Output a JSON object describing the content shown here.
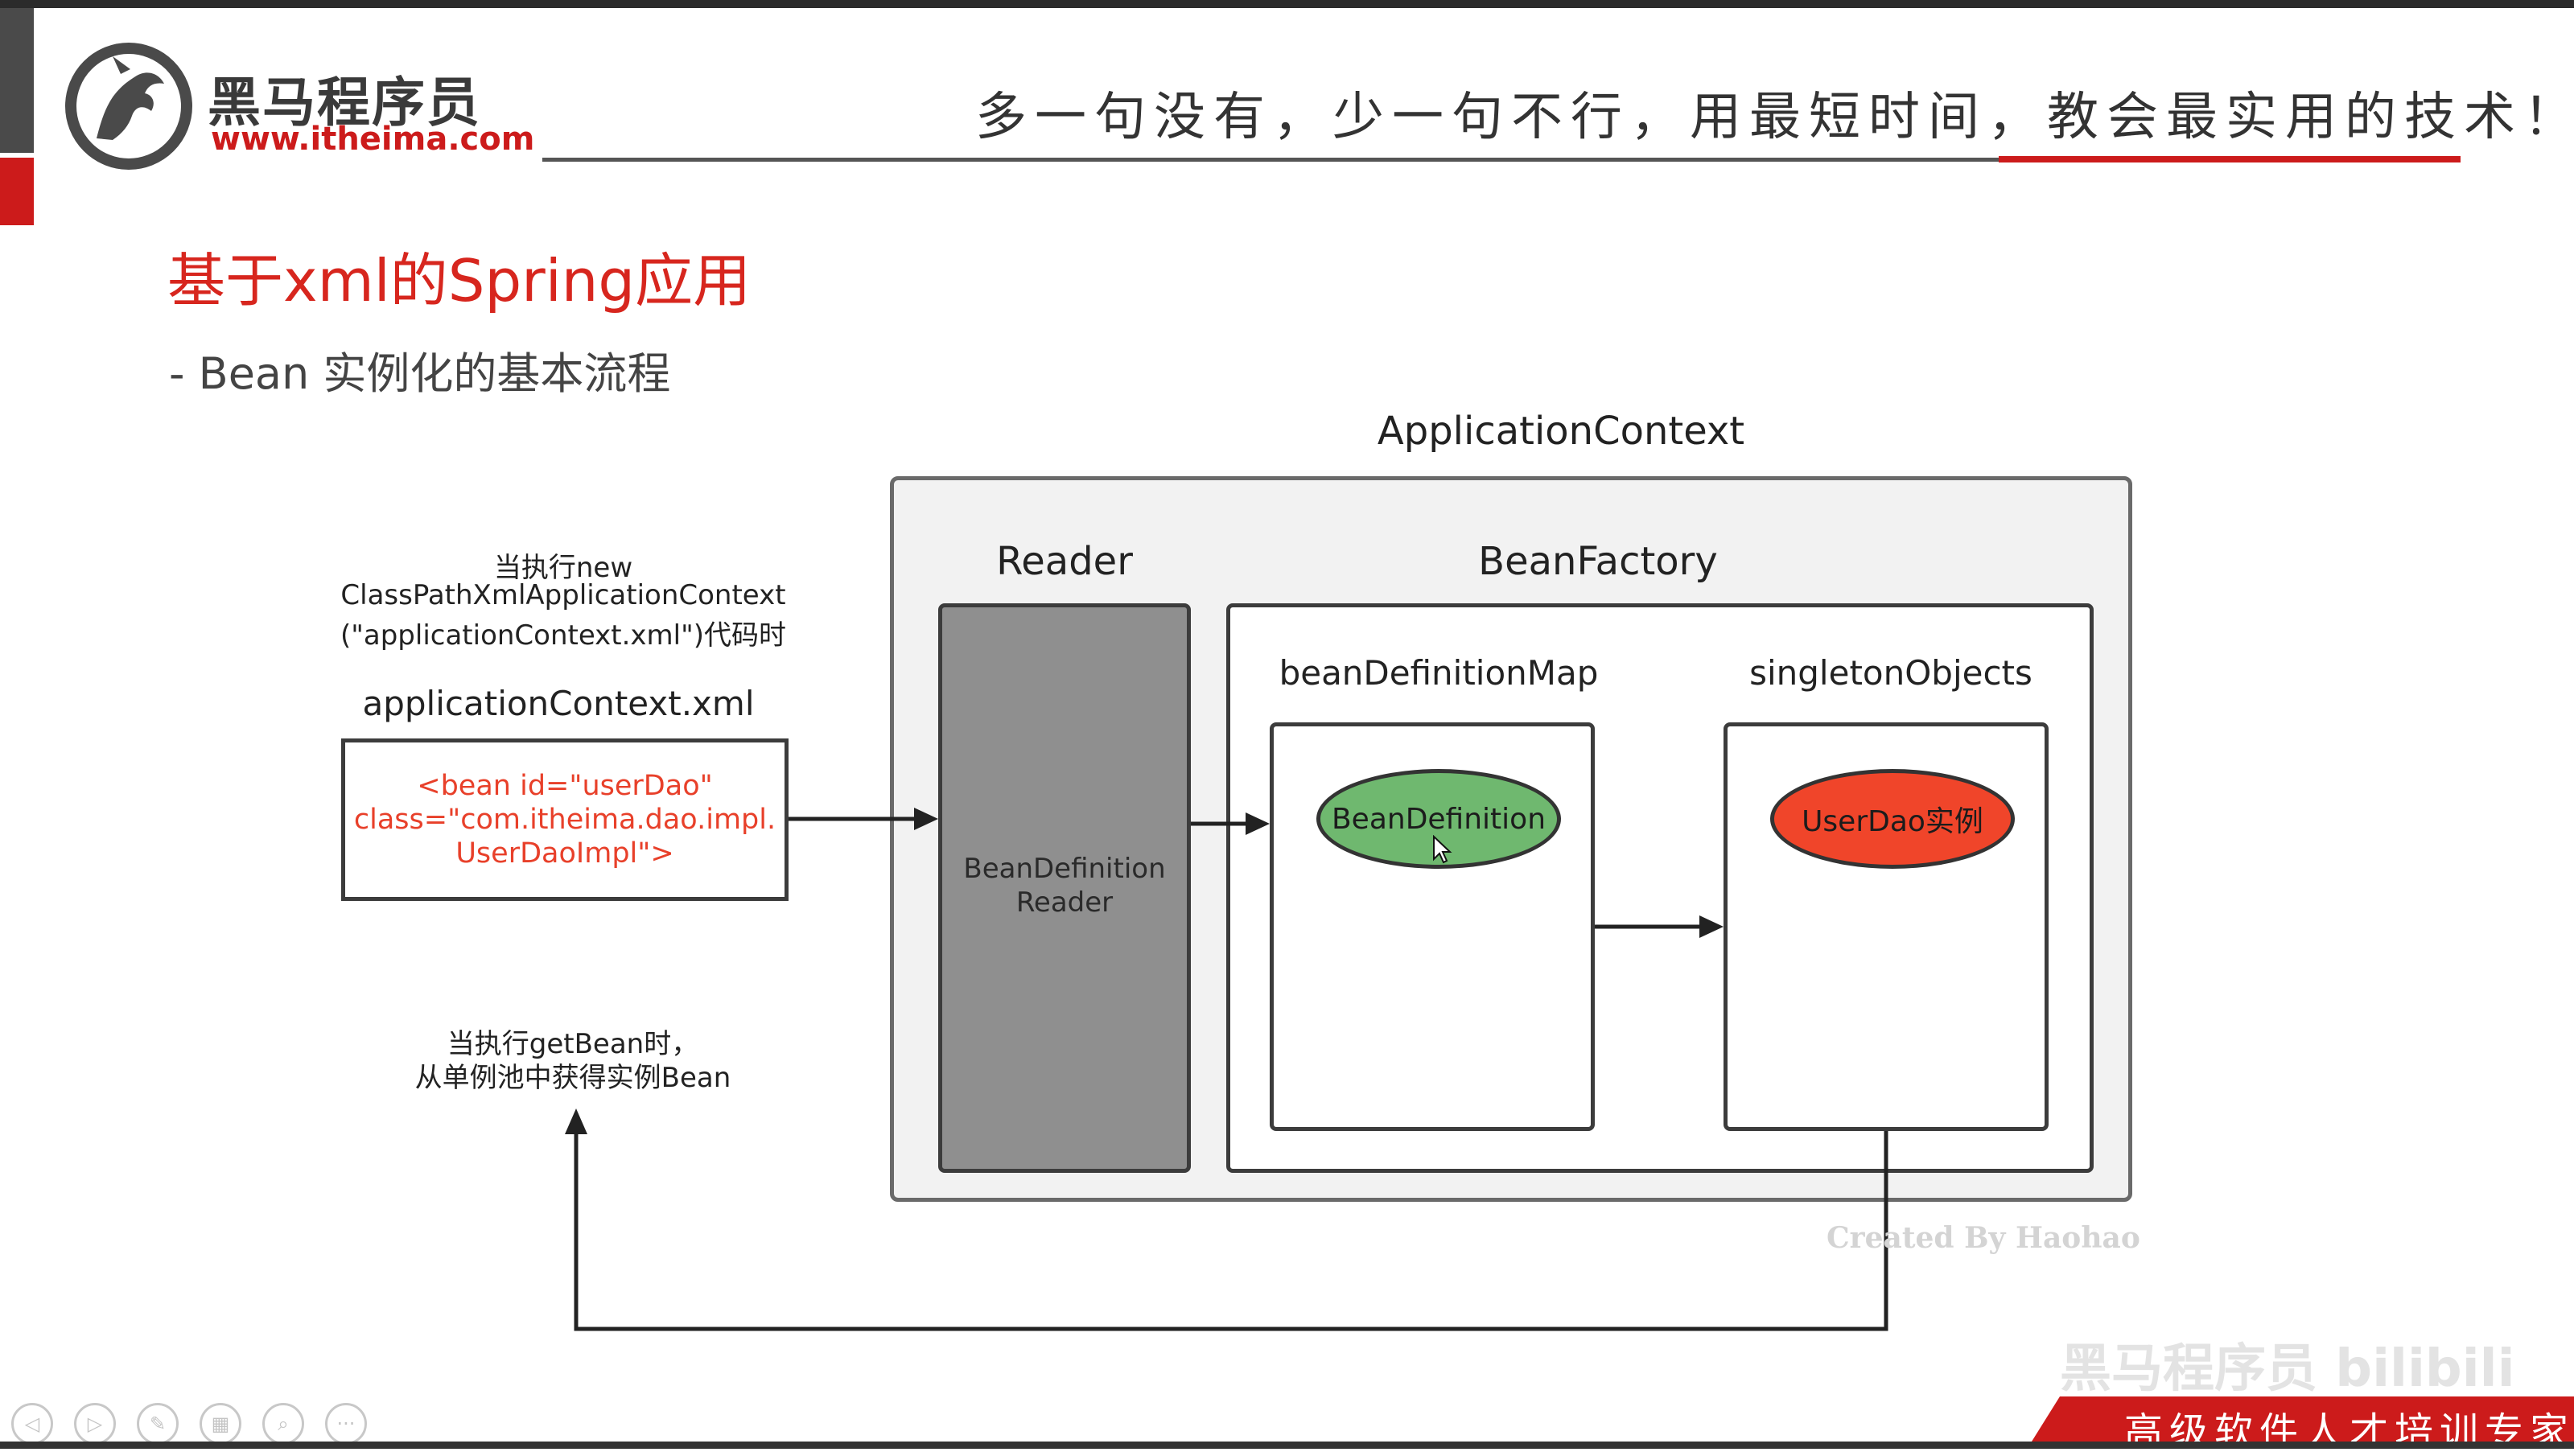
{
  "header": {
    "logo_name": "黑马程序员",
    "logo_url": "www.itheima.com",
    "slogan": "多一句没有，少一句不行，用最短时间，教会最实用的技术！"
  },
  "page": {
    "title": "基于xml的Spring应用",
    "subtitle": "- Bean 实例化的基本流程"
  },
  "diagram": {
    "application_context_label": "ApplicationContext",
    "reader_label": "Reader",
    "bean_factory_label": "BeanFactory",
    "bean_definition_map_label": "beanDefinitionMap",
    "singleton_objects_label": "singletonObjects",
    "reader_box_text_line1": "BeanDefinition",
    "reader_box_text_line2": "Reader",
    "bean_definition_ellipse": "BeanDefinition",
    "userdao_ellipse": "UserDao实例",
    "note_new_line1": "当执行new",
    "note_new_line2": "ClassPathXmlApplicationContext",
    "note_new_line3": "(\"applicationContext.xml\")代码时",
    "xml_file_label": "applicationContext.xml",
    "xml_code": "<bean id=\"userDao\"\nclass=\"com.itheima.dao.impl.\nUserDaoImpl\">",
    "note_getbean_line1": "当执行getBean时，",
    "note_getbean_line2": "从单例池中获得实例Bean",
    "watermark": "Created By Haohao"
  },
  "footer": {
    "banner": "高级软件人才培训专家",
    "corner_watermark": "黑马程序员 bilibili",
    "nav_buttons": [
      {
        "name": "prev-slide-icon",
        "glyph": "◁"
      },
      {
        "name": "next-slide-icon",
        "glyph": "▷"
      },
      {
        "name": "pen-icon",
        "glyph": "✎"
      },
      {
        "name": "slides-grid-icon",
        "glyph": "▦"
      },
      {
        "name": "zoom-icon",
        "glyph": "⌕"
      },
      {
        "name": "more-icon",
        "glyph": "···"
      }
    ]
  },
  "colors": {
    "accent_red": "#cc1b1b",
    "title_red": "#d7261e",
    "bean_definition_green": "#6fb86f",
    "userdao_red": "#f0452a",
    "reader_gray": "#8f8f8f"
  }
}
